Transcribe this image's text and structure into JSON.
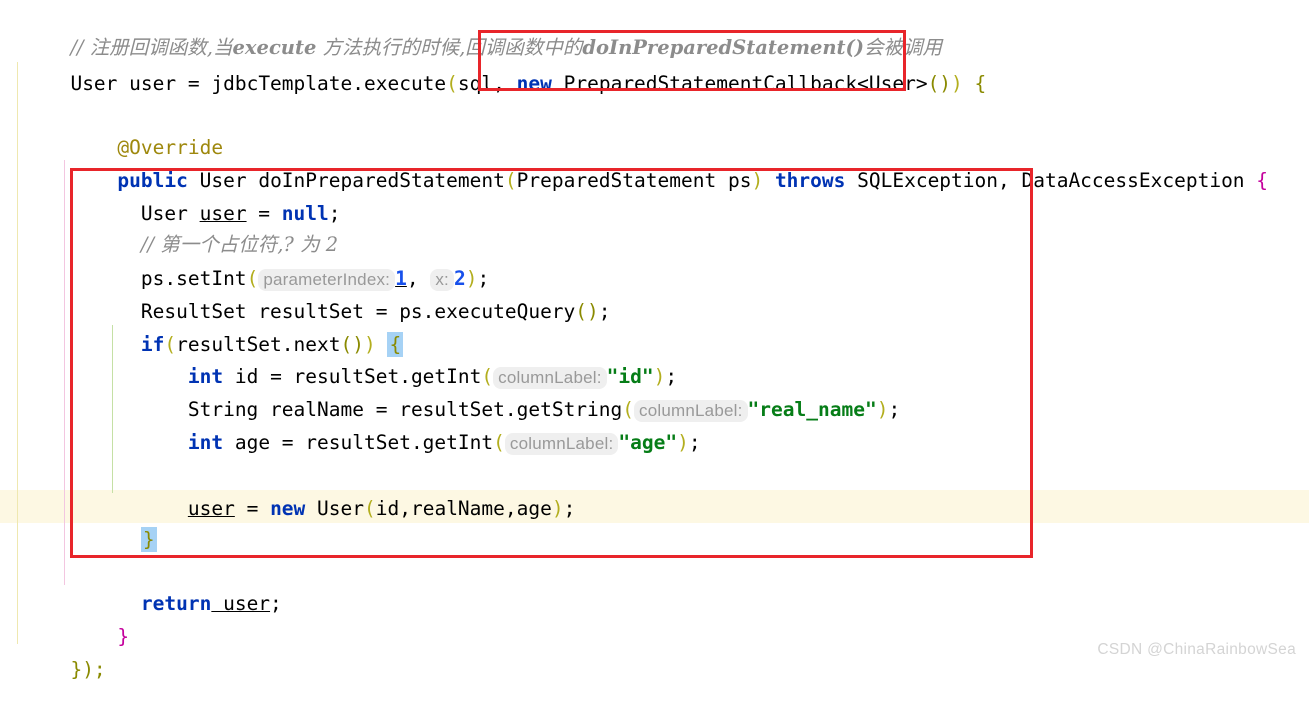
{
  "editor": {
    "background_color": "#ffffff",
    "current_line_color": "#fdf8e3",
    "annotation_box_color": "#e8252a",
    "brace_match_color": "#a6d2f5",
    "inlay_hint_bg_color": "#efefef",
    "inlay_hint_text_color": "#999999"
  },
  "code": {
    "line1_comment": "// 注册回调函数,当execute 方法执行的时候,回调函数中的doInPreparedStatement() 会被调用",
    "line1_parts": {
      "slashes": "// ",
      "seg_a": "注册回调函数,当",
      "bold_a": "execute",
      "seg_b": " 方法执行的时候,回调函数中的",
      "bold_b": "doInPreparedStatement()",
      "seg_c": "会被调用"
    },
    "line2": {
      "indent": "",
      "type": "User",
      "var": " user ",
      "eq": "= ",
      "call": "jdbcTemplate.execute",
      "paren_open": "(",
      "arg1": "sql",
      "comma": ", ",
      "kw_new": "new",
      "ctor": " PreparedStatementCallback<User>",
      "paren2": "()",
      "paren_close": ")",
      "brace": " {"
    },
    "line4_annotation": "@Override",
    "line5": {
      "kw_public": "public",
      "ret": " User ",
      "method": "doInPreparedStatement",
      "paren_open": "(",
      "param_type": "PreparedStatement",
      "param_name": " ps",
      "paren_close": ")",
      "kw_throws": " throws ",
      "ex1": "SQLException, DataAccessException",
      "brace": " {"
    },
    "line6": {
      "type": "User ",
      "var": "user",
      "eq": " = ",
      "kw_null": "null",
      "semi": ";"
    },
    "line7_comment": "// 第一个占位符,? 为 2",
    "line8": {
      "obj": "ps.setInt",
      "paren_open": "(",
      "hint1": "parameterIndex:",
      "val1": "1",
      "comma": ", ",
      "hint2": "x:",
      "val2": "2",
      "paren_close": ")",
      "semi": ";"
    },
    "line9": {
      "type": "ResultSet",
      "var": " resultSet ",
      "eq": "= ",
      "call": "ps.executeQuery",
      "parens": "()",
      "semi": ";"
    },
    "line10": {
      "kw_if": "if",
      "paren_open": "(",
      "cond": "resultSet.next",
      "inner_parens": "()",
      "paren_close": ")",
      "brace": "{"
    },
    "line11": {
      "kw_int": "int",
      "var": " id ",
      "eq": "= ",
      "call": "resultSet.getInt",
      "paren_open": "(",
      "hint": "columnLabel:",
      "str": "\"id\"",
      "paren_close": ")",
      "semi": ";"
    },
    "line12": {
      "type": "String",
      "var": " realName ",
      "eq": "= ",
      "call": "resultSet.getString",
      "paren_open": "(",
      "hint": "columnLabel:",
      "str": "\"real_name\"",
      "paren_close": ")",
      "semi": ";"
    },
    "line13": {
      "kw_int": "int",
      "var": " age ",
      "eq": "= ",
      "call": "resultSet.getInt",
      "paren_open": "(",
      "hint": "columnLabel:",
      "str": "\"age\"",
      "paren_close": ")",
      "semi": ";"
    },
    "line15": {
      "var": "user",
      "eq": " = ",
      "kw_new": "new",
      "ctor": " User",
      "paren_open": "(",
      "args": "id,realName,age",
      "paren_close": ")",
      "semi": ";"
    },
    "line16_close_brace": "}",
    "line17": {
      "kw_return": "return",
      "var": " user",
      "semi": ";"
    },
    "line18_close_brace": "}",
    "line19_close": "});"
  },
  "watermark": "CSDN @ChinaRainbowSea"
}
